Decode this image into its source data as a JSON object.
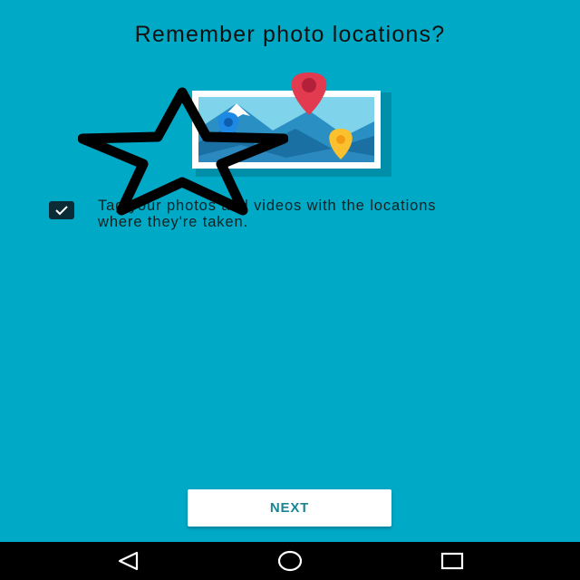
{
  "title": "Remember photo locations?",
  "checkbox": {
    "checked": true,
    "label": "Tag your photos and videos with the locations where they're taken."
  },
  "buttons": {
    "next_label": "NEXT"
  },
  "icons": {
    "illustration": "photo-with-location-pins",
    "overlay": "star-outline-icon",
    "checkbox": "check-icon",
    "nav_back": "triangle-back-icon",
    "nav_home": "circle-home-icon",
    "nav_recents": "square-recents-icon"
  },
  "colors": {
    "background": "#00a9c6",
    "button_text": "#1a8592",
    "pin_red": "#e23a4e",
    "pin_blue": "#1e88e5",
    "pin_yellow": "#fbc02d"
  }
}
